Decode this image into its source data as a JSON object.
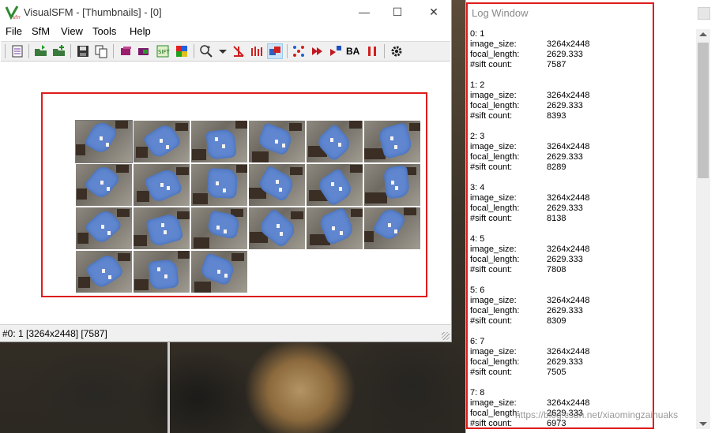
{
  "app": {
    "title": "VisualSFM - [Thumbnails] - [0]",
    "icon": "visualsfm-logo-icon"
  },
  "window_controls": {
    "minimize": "—",
    "maximize": "☐",
    "close": "✕"
  },
  "menu": [
    {
      "label": "File"
    },
    {
      "label": "SfM"
    },
    {
      "label": "View"
    },
    {
      "label": "Tools"
    },
    {
      "label": "Help"
    }
  ],
  "toolbar": {
    "tools": [
      "notepad-icon",
      "open-folder-icon",
      "open-add-icon",
      "save-icon",
      "copy-icon",
      "cube-purple-icon",
      "cube-purple-pair-icon",
      "sift-icon",
      "color-grid-icon",
      "zoom-icon",
      "dropdown-arrow-icon",
      "match-tool-icon",
      "bars-icon",
      "pair-view-icon",
      "scatter-icon",
      "forward-icon",
      "sparse-icon",
      "ba-label",
      "pause-icon",
      "settings-gear-icon"
    ],
    "ba_label": "BA"
  },
  "thumbnails": {
    "count": 21,
    "selected_index": 0
  },
  "status": {
    "text": "#0: 1 [3264x2448] [7587]"
  },
  "log_window": {
    "title": "Log Window",
    "labels": {
      "image_size": "image_size:",
      "focal_length": "focal_length:",
      "sift_count": "#sift count:"
    },
    "entries": [
      {
        "header": "0: 1",
        "image_size": "3264x2448",
        "focal_length": "2629.333",
        "sift_count": "7587"
      },
      {
        "header": "1: 2",
        "image_size": "3264x2448",
        "focal_length": "2629.333",
        "sift_count": "8393"
      },
      {
        "header": "2: 3",
        "image_size": "3264x2448",
        "focal_length": "2629.333",
        "sift_count": "8289"
      },
      {
        "header": "3: 4",
        "image_size": "3264x2448",
        "focal_length": "2629.333",
        "sift_count": "8138"
      },
      {
        "header": "4: 5",
        "image_size": "3264x2448",
        "focal_length": "2629.333",
        "sift_count": "7808"
      },
      {
        "header": "5: 6",
        "image_size": "3264x2448",
        "focal_length": "2629.333",
        "sift_count": "8309"
      },
      {
        "header": "6: 7",
        "image_size": "3264x2448",
        "focal_length": "2629.333",
        "sift_count": "7505"
      },
      {
        "header": "7: 8",
        "image_size": "3264x2448",
        "focal_length": "2629.333",
        "sift_count": "6973"
      }
    ],
    "watermark": "https://blog.csdn.net/xiaomingzaihuaks"
  },
  "colors": {
    "highlight": "#e01b1b",
    "cloth": "#5f86cf"
  }
}
